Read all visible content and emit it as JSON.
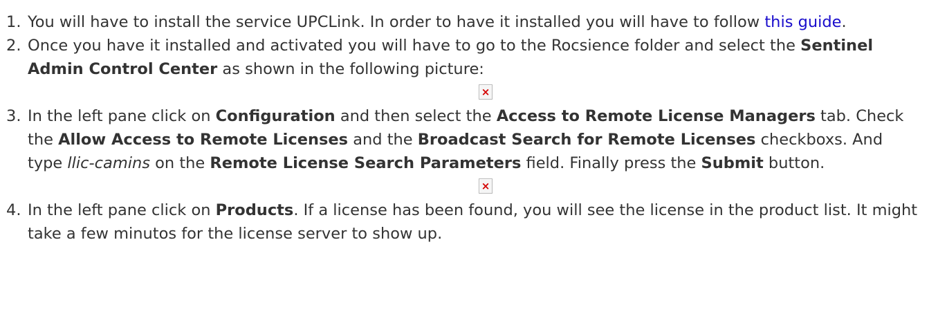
{
  "steps": [
    {
      "number": "1.",
      "t1": "You will have to install the service UPCLink. In order to have it installed you will have to follow ",
      "link": "this guide",
      "t2": "."
    },
    {
      "number": "2.",
      "t1": "Once you have it installed and activated you will have to go to the Rocsience folder and select the ",
      "b1": "Sentinel Admin Control Center",
      "t2": " as shown in the following picture:"
    },
    {
      "number": "3.",
      "t1": "In the left pane click on ",
      "b1": "Configuration",
      "t2": " and then select the ",
      "b2": "Access to Remote License Managers",
      "t3": " tab. Check the ",
      "b3": "Allow Access to Remote Licenses",
      "t4": " and the ",
      "b4": "Broadcast Search for Remote Licenses",
      "t5": " checkboxs. And type ",
      "i1": "llic-camins",
      "t6": " on the ",
      "b5": "Remote License Search Parameters",
      "t7": " field. Finally press the ",
      "b6": "Submit",
      "t8": " button."
    },
    {
      "number": "4.",
      "t1": "In the left pane click on ",
      "b1": "Products",
      "t2": ". If a license has been found, you will see the license in the product list. It might take a few minutos for the license server to show up."
    }
  ],
  "broken_image": {
    "icon": "broken-image-icon",
    "glyph": "×",
    "color": "#d40000"
  },
  "colors": {
    "text": "#333333",
    "link": "#1a0dcc"
  }
}
